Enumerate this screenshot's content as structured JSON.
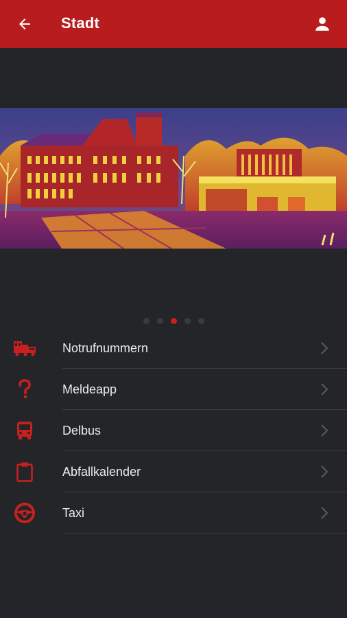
{
  "appbar": {
    "title": "Stadt",
    "back_icon": "arrow-left-icon",
    "profile_icon": "user-icon",
    "background_color": "#b81c1c"
  },
  "carousel": {
    "slide_count": 5,
    "active_index": 2,
    "active_dot_color": "#c8201f"
  },
  "menu": {
    "items": [
      {
        "label": "Notrufnummern",
        "icon": "emergency-vehicles-icon"
      },
      {
        "label": "Meldeapp",
        "icon": "question-mark-icon"
      },
      {
        "label": "Delbus",
        "icon": "bus-icon"
      },
      {
        "label": "Abfallkalender",
        "icon": "clipboard-icon"
      },
      {
        "label": "Taxi",
        "icon": "steering-wheel-icon"
      }
    ],
    "icon_color": "#c8201f"
  }
}
